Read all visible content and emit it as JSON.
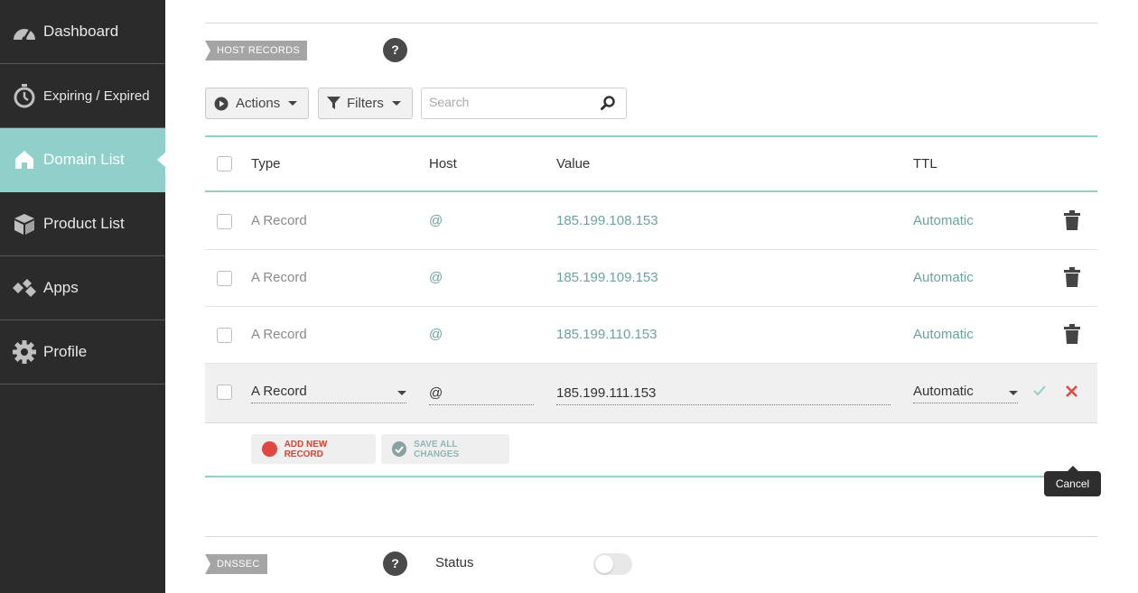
{
  "sidebar": {
    "items": [
      {
        "label": "Dashboard",
        "icon": "dashboard-icon"
      },
      {
        "label": "Expiring / Expired",
        "icon": "stopwatch-icon"
      },
      {
        "label": "Domain List",
        "icon": "house-icon",
        "active": true
      },
      {
        "label": "Product List",
        "icon": "box-icon"
      },
      {
        "label": "Apps",
        "icon": "diamonds-icon"
      },
      {
        "label": "Profile",
        "icon": "gear-icon"
      }
    ]
  },
  "host_records": {
    "tag": "HOST RECORDS",
    "help": "?",
    "actions_label": "Actions",
    "filters_label": "Filters",
    "search_placeholder": "Search",
    "columns": {
      "type": "Type",
      "host": "Host",
      "value": "Value",
      "ttl": "TTL"
    },
    "rows": [
      {
        "type": "A Record",
        "host": "@",
        "value": "185.199.108.153",
        "ttl": "Automatic"
      },
      {
        "type": "A Record",
        "host": "@",
        "value": "185.199.109.153",
        "ttl": "Automatic"
      },
      {
        "type": "A Record",
        "host": "@",
        "value": "185.199.110.153",
        "ttl": "Automatic"
      }
    ],
    "edit_row": {
      "type": "A Record",
      "host": "@",
      "value": "185.199.111.153",
      "ttl": "Automatic"
    },
    "add_new_label": "ADD NEW RECORD",
    "save_all_label": "SAVE ALL CHANGES",
    "cancel_tooltip": "Cancel"
  },
  "dnssec": {
    "tag": "DNSSEC",
    "help": "?",
    "status_label": "Status",
    "enabled": false
  },
  "colors": {
    "sidebar_bg": "#2b2b2b",
    "accent": "#8fd0cb",
    "danger": "#e0473f",
    "confirm": "#8fd0cb"
  }
}
